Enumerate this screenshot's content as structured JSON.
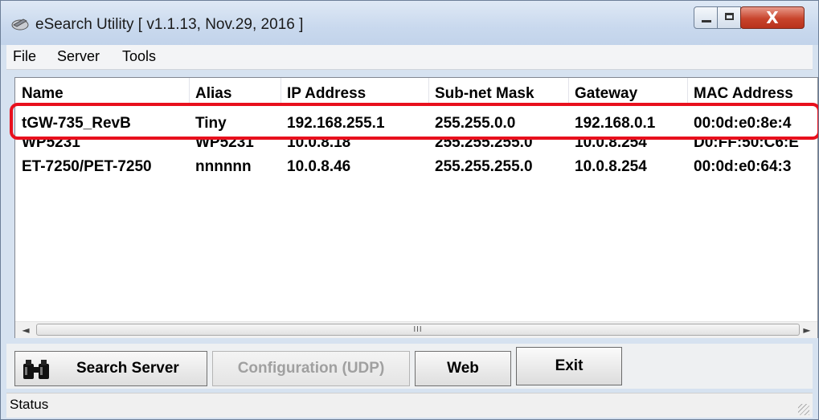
{
  "window": {
    "title": "eSearch Utility [ v1.1.13, Nov.29, 2016 ]",
    "controls": {
      "close_glyph": "X"
    }
  },
  "menu": {
    "items": [
      {
        "label": "File"
      },
      {
        "label": "Server"
      },
      {
        "label": "Tools"
      }
    ]
  },
  "list": {
    "columns": [
      "Name",
      "Alias",
      "IP Address",
      "Sub-net Mask",
      "Gateway",
      "MAC Address"
    ],
    "rows": [
      {
        "name": "tGW-735_RevB",
        "alias": "Tiny",
        "ip": "192.168.255.1",
        "mask": "255.255.0.0",
        "gateway": "192.168.0.1",
        "mac": "00:0d:e0:8e:4",
        "highlighted": true
      },
      {
        "name": "WP5231",
        "alias": "WP5231",
        "ip": "10.0.8.18",
        "mask": "255.255.255.0",
        "gateway": "10.0.8.254",
        "mac": "D0:FF:50:C6:E"
      },
      {
        "name": "ET-7250/PET-7250",
        "alias": "nnnnnn",
        "ip": "10.0.8.46",
        "mask": "255.255.255.0",
        "gateway": "10.0.8.254",
        "mac": "00:0d:e0:64:3"
      }
    ]
  },
  "scrollbar": {
    "left_arrow": "◄",
    "right_arrow": "►",
    "grip": "III"
  },
  "buttons": {
    "search": "Search Server",
    "config": "Configuration (UDP)",
    "web": "Web",
    "exit": "Exit"
  },
  "status": {
    "text": "Status"
  },
  "colors": {
    "highlight_border": "#e8101d",
    "disabled_text": "#a0a0a0"
  }
}
